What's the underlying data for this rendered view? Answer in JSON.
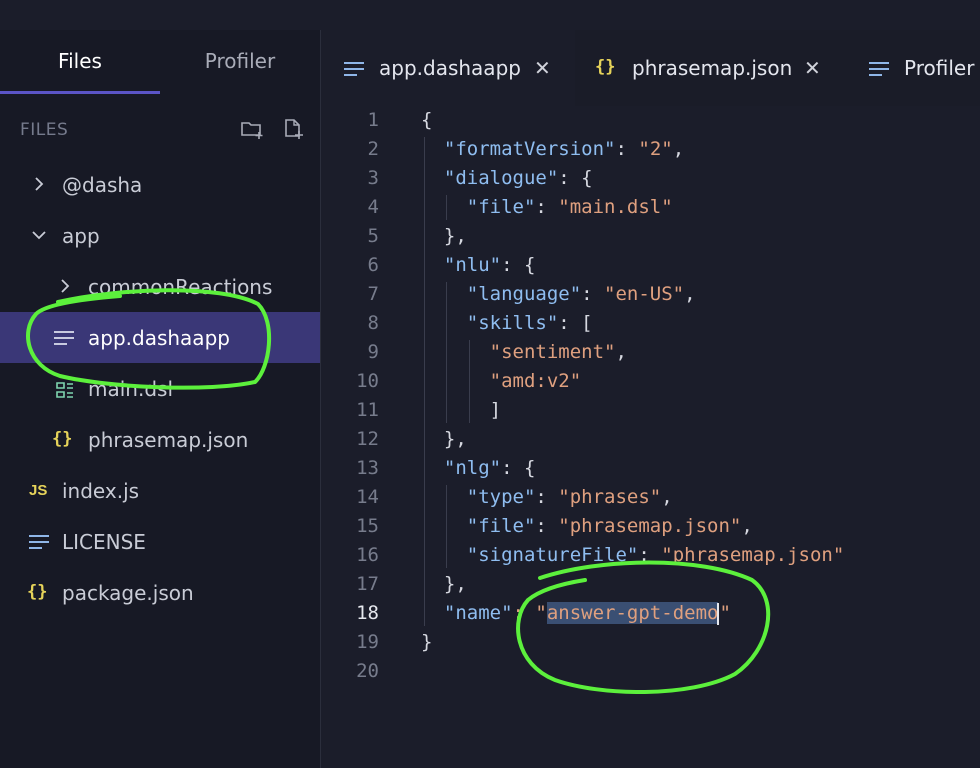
{
  "sidebar": {
    "tabs": [
      {
        "label": "Files",
        "active": true
      },
      {
        "label": "Profiler",
        "active": false
      }
    ],
    "section_title": "FILES",
    "items": [
      {
        "label": "@dasha",
        "icon": "chevron-right-icon"
      },
      {
        "label": "app",
        "icon": "chevron-down-icon"
      },
      {
        "label": "commonReactions",
        "icon": "chevron-right-icon"
      },
      {
        "label": "app.dashaapp",
        "icon": "lines-icon",
        "selected": true
      },
      {
        "label": "main.dsl",
        "icon": "dsl-file-icon"
      },
      {
        "label": "phrasemap.json",
        "icon": "braces-icon",
        "glyph": "{}"
      },
      {
        "label": "index.js",
        "icon": "js-file-icon",
        "glyph": "JS"
      },
      {
        "label": "LICENSE",
        "icon": "lines-icon"
      },
      {
        "label": "package.json",
        "icon": "braces-icon",
        "glyph": "{}"
      }
    ]
  },
  "editor": {
    "tabs": [
      {
        "label": "app.dashaapp",
        "icon": "lines-icon",
        "active": true,
        "close": "✕"
      },
      {
        "label": "phrasemap.json",
        "icon": "braces-icon",
        "glyph": "{}",
        "close": "✕"
      },
      {
        "label": "Profiler",
        "icon": "lines-icon"
      }
    ],
    "current_line": 18,
    "lines": [
      [
        "{"
      ],
      [
        "  ",
        "\"formatVersion\"",
        ": ",
        "\"2\"",
        ","
      ],
      [
        "  ",
        "\"dialogue\"",
        ": {"
      ],
      [
        "    ",
        "\"file\"",
        ": ",
        "\"main.dsl\""
      ],
      [
        "  },"
      ],
      [
        "  ",
        "\"nlu\"",
        ": {"
      ],
      [
        "    ",
        "\"language\"",
        ": ",
        "\"en-US\"",
        ","
      ],
      [
        "    ",
        "\"skills\"",
        ": ["
      ],
      [
        "      ",
        "\"sentiment\"",
        ","
      ],
      [
        "      ",
        "\"amd:v2\""
      ],
      [
        "      ]"
      ],
      [
        "  },"
      ],
      [
        "  ",
        "\"nlg\"",
        ": {"
      ],
      [
        "    ",
        "\"type\"",
        ": ",
        "\"phrases\"",
        ","
      ],
      [
        "    ",
        "\"file\"",
        ": ",
        "\"phrasemap.json\"",
        ","
      ],
      [
        "    ",
        "\"signatureFile\"",
        ": ",
        "\"phrasemap.json\""
      ],
      [
        "  },"
      ],
      [
        "  ",
        "\"name\"",
        ": \"",
        "answer-gpt-demo",
        "\""
      ],
      [
        "}"
      ],
      [
        ""
      ]
    ]
  },
  "colors": {
    "accent": "#5b54c7",
    "selected_row": "#3a3777",
    "json_key": "#8fbdf0",
    "json_string": "#dfa07f",
    "annotation": "#5cf03c",
    "braces_icon": "#e6d35a"
  }
}
